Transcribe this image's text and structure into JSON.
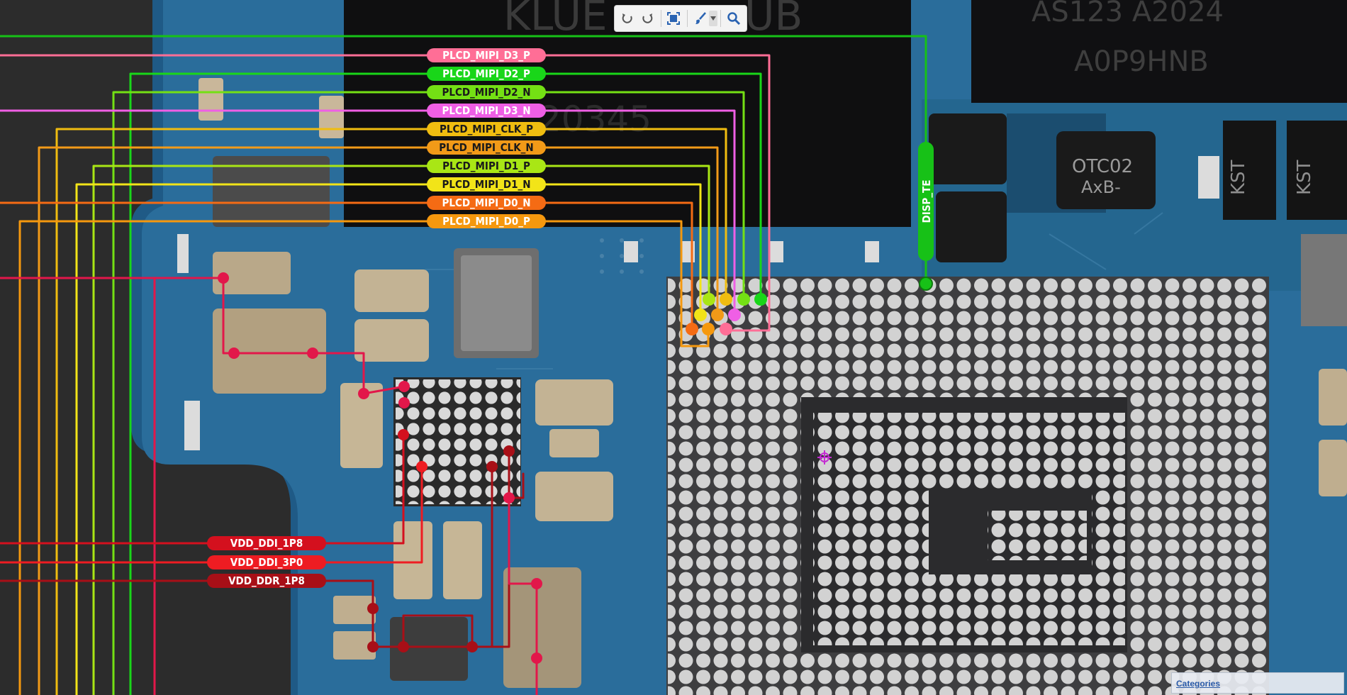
{
  "toolbar": {
    "tools": [
      "rotate-left-icon",
      "rotate-right-icon",
      "fit-view-icon",
      "brush-tool-icon",
      "dropdown-chevron-icon",
      "search-icon"
    ]
  },
  "board_text": {
    "chip_marking_left": "KLUE",
    "chip_marking_left_tail": "UB",
    "chip_marking_right_1": "AS123   A2024",
    "chip_marking_right_2": "A0P9HNB",
    "chip_marking_mirrored": "20345",
    "small_ic_1": "OTC02",
    "small_ic_2": "AxB-",
    "kst_1": "KST",
    "kst_2": "KST"
  },
  "nets": [
    {
      "name": "PLCD_MIPI_D3_P",
      "color": "#ff6e96"
    },
    {
      "name": "PLCD_MIPI_D2_P",
      "color": "#19d619"
    },
    {
      "name": "PLCD_MIPI_D2_N",
      "color": "#74e014"
    },
    {
      "name": "PLCD_MIPI_D3_N",
      "color": "#ef5fe5"
    },
    {
      "name": "PLCD_MIPI_CLK_P",
      "color": "#f0bd10"
    },
    {
      "name": "PLCD_MIPI_CLK_N",
      "color": "#f29a18"
    },
    {
      "name": "PLCD_MIPI_D1_P",
      "color": "#a9e615"
    },
    {
      "name": "PLCD_MIPI_D1_N",
      "color": "#f2e418"
    },
    {
      "name": "PLCD_MIPI_D0_N",
      "color": "#f56b14"
    },
    {
      "name": "PLCD_MIPI_D0_P",
      "color": "#f5980e"
    }
  ],
  "power_nets": [
    {
      "name": "VDD_DDI_1P8",
      "color": "#d4101e"
    },
    {
      "name": "VDD_DDI_3P0",
      "color": "#ee1c22"
    },
    {
      "name": "VDD_DDR_1P8",
      "color": "#a80f17"
    }
  ],
  "disp_te": {
    "name": "DISP_TE",
    "color": "#17c117"
  },
  "categories_label": "Categories"
}
